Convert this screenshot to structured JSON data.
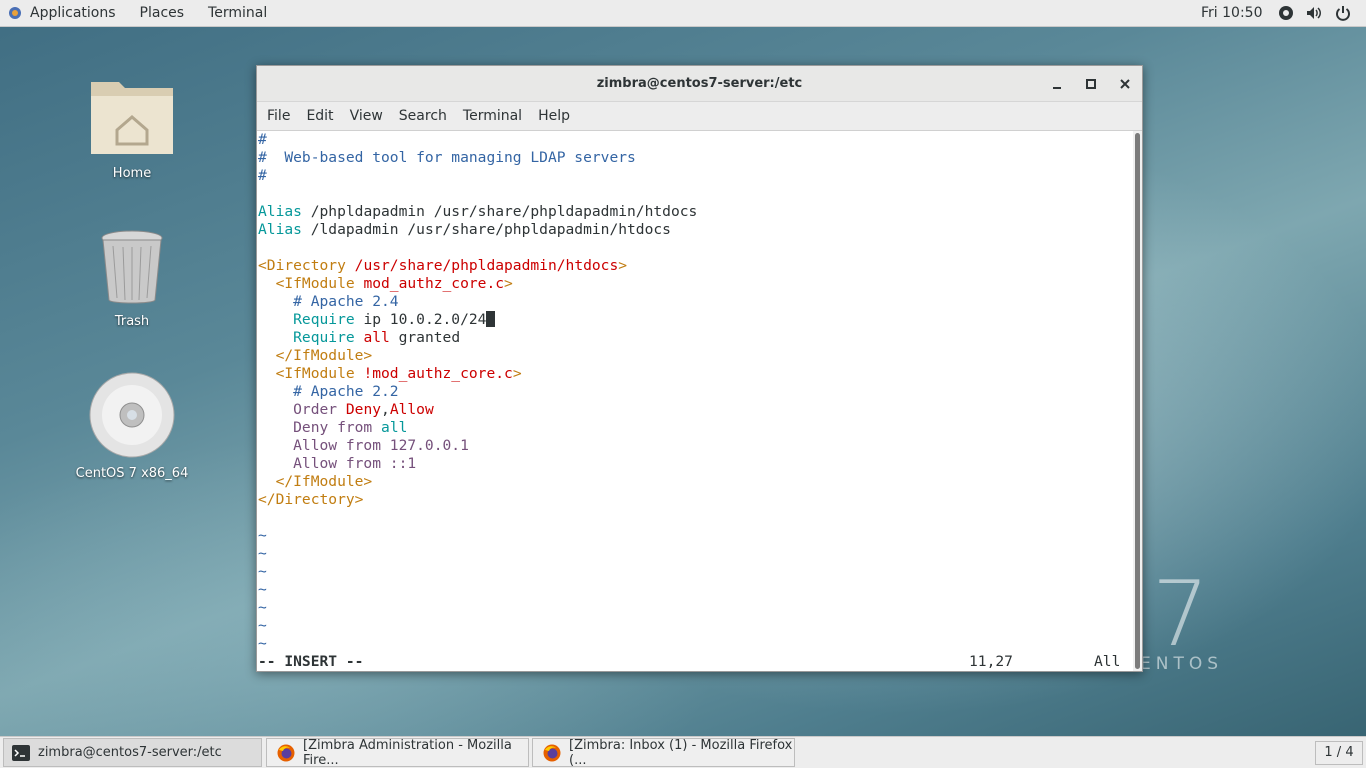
{
  "topbar": {
    "applications": "Applications",
    "places": "Places",
    "terminal": "Terminal",
    "clock": "Fri 10:50",
    "tray_icons": [
      "accessibility-icon",
      "volume-icon",
      "power-icon"
    ]
  },
  "desktop": {
    "icons": [
      {
        "label": "Home",
        "icon": "home-folder-icon"
      },
      {
        "label": "Trash",
        "icon": "trash-icon"
      },
      {
        "label": "CentOS 7 x86_64",
        "icon": "disc-icon"
      }
    ],
    "watermark_number": "7",
    "watermark_text": "ENTOS"
  },
  "window": {
    "title": "zimbra@centos7-server:/etc",
    "menu": [
      "File",
      "Edit",
      "View",
      "Search",
      "Terminal",
      "Help"
    ]
  },
  "editor": {
    "lines": [
      [
        {
          "t": "#",
          "c": "cmt"
        }
      ],
      [
        {
          "t": "#  Web-based tool for managing LDAP servers",
          "c": "cmt"
        }
      ],
      [
        {
          "t": "#",
          "c": "cmt"
        }
      ],
      [],
      [
        {
          "t": "Alias",
          "c": "kw"
        },
        {
          "t": " /phpldapadmin /usr/share/phpldapadmin/htdocs",
          "c": ""
        }
      ],
      [
        {
          "t": "Alias",
          "c": "kw"
        },
        {
          "t": " /ldapadmin /usr/share/phpldapadmin/htdocs",
          "c": ""
        }
      ],
      [],
      [
        {
          "t": "<Directory",
          "c": "tagb"
        },
        {
          "t": " /usr/share/phpldapadmin/htdocs",
          "c": "str"
        },
        {
          "t": ">",
          "c": "tagb"
        }
      ],
      [
        {
          "t": "  <IfModule",
          "c": "tagb"
        },
        {
          "t": " mod_authz_core.c",
          "c": "str"
        },
        {
          "t": ">",
          "c": "tagb"
        }
      ],
      [
        {
          "t": "    # Apache 2.4",
          "c": "cmt"
        }
      ],
      [
        {
          "t": "    Require",
          "c": "kw"
        },
        {
          "t": " ip 10.0.2.0/24",
          "c": ""
        },
        {
          "t": "",
          "c": "cursor"
        }
      ],
      [
        {
          "t": "    Require",
          "c": "kw"
        },
        {
          "t": " ",
          "c": ""
        },
        {
          "t": "all",
          "c": "str"
        },
        {
          "t": " granted",
          "c": ""
        }
      ],
      [
        {
          "t": "  </IfModule>",
          "c": "tagb"
        }
      ],
      [
        {
          "t": "  <IfModule",
          "c": "tagb"
        },
        {
          "t": " !mod_authz_core.c",
          "c": "str"
        },
        {
          "t": ">",
          "c": "tagb"
        }
      ],
      [
        {
          "t": "    # Apache 2.2",
          "c": "cmt"
        }
      ],
      [
        {
          "t": "    Order",
          "c": "pur"
        },
        {
          "t": " ",
          "c": ""
        },
        {
          "t": "Deny",
          "c": "str"
        },
        {
          "t": ",",
          "c": ""
        },
        {
          "t": "Allow",
          "c": "str"
        }
      ],
      [
        {
          "t": "    Deny from",
          "c": "pur"
        },
        {
          "t": " ",
          "c": ""
        },
        {
          "t": "all",
          "c": "kw"
        }
      ],
      [
        {
          "t": "    Allow from 127.0.0.1",
          "c": "pur"
        }
      ],
      [
        {
          "t": "    Allow from ::1",
          "c": "pur"
        }
      ],
      [
        {
          "t": "  </IfModule>",
          "c": "tagb"
        }
      ],
      [
        {
          "t": "</Directory>",
          "c": "tagb"
        }
      ],
      [],
      [
        {
          "t": "~",
          "c": "tilde"
        }
      ],
      [
        {
          "t": "~",
          "c": "tilde"
        }
      ],
      [
        {
          "t": "~",
          "c": "tilde"
        }
      ],
      [
        {
          "t": "~",
          "c": "tilde"
        }
      ],
      [
        {
          "t": "~",
          "c": "tilde"
        }
      ],
      [
        {
          "t": "~",
          "c": "tilde"
        }
      ],
      [
        {
          "t": "~",
          "c": "tilde"
        }
      ]
    ],
    "mode": "-- INSERT --",
    "position": "11,27",
    "scroll": "All"
  },
  "taskbar": {
    "tasks": [
      {
        "label": "zimbra@centos7-server:/etc",
        "icon": "terminal-icon"
      },
      {
        "label": "[Zimbra Administration - Mozilla Fire...",
        "icon": "firefox-icon"
      },
      {
        "label": "[Zimbra: Inbox (1) - Mozilla Firefox (...",
        "icon": "firefox-icon"
      }
    ],
    "pager": "1 / 4"
  }
}
